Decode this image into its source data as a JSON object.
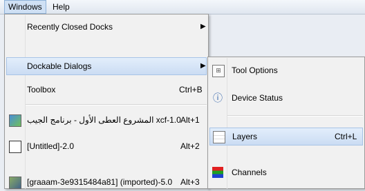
{
  "menubar": {
    "windows": "Windows",
    "help": "Help"
  },
  "windows_menu": {
    "recently_closed_docks": "Recently Closed Docks",
    "dockable_dialogs": "Dockable Dialogs",
    "toolbox": "Toolbox",
    "toolbox_shortcut": "Ctrl+B",
    "images": [
      {
        "label": "المشروع العطى الأول - برنامج الجيب xcf-1.0",
        "shortcut": "Alt+1"
      },
      {
        "label": "[Untitled]-2.0",
        "shortcut": "Alt+2"
      },
      {
        "label": "[graaam-3e9315484a81] (imported)-5.0",
        "shortcut": "Alt+3"
      }
    ]
  },
  "dockable_menu": {
    "tool_options": "Tool Options",
    "device_status": "Device Status",
    "layers": "Layers",
    "layers_shortcut": "Ctrl+L",
    "channels": "Channels"
  },
  "colors": {
    "highlight": "#cbdcf3",
    "menu_bg": "#f1f1f1"
  }
}
